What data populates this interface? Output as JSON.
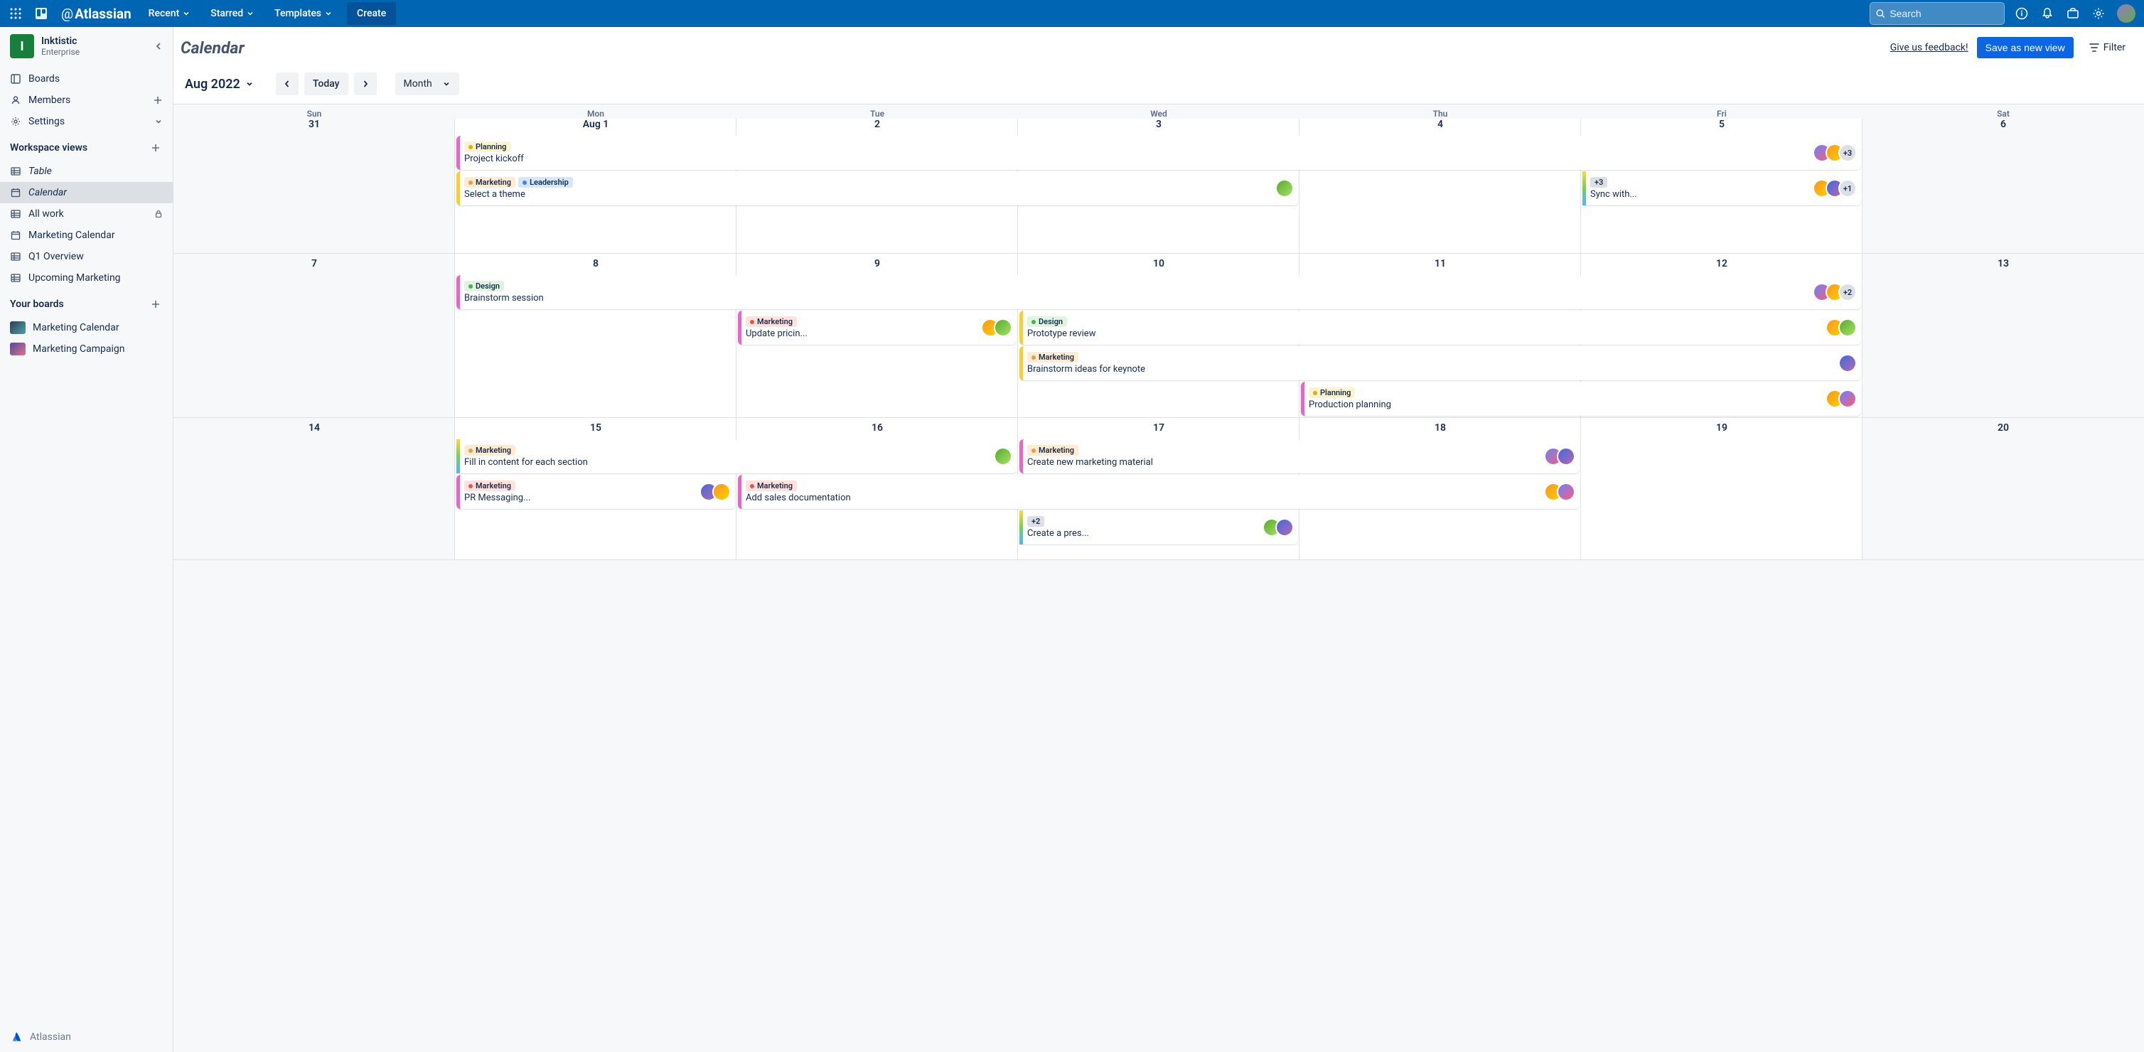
{
  "topbar": {
    "brand": "Atlassian",
    "menus": {
      "recent": "Recent",
      "starred": "Starred",
      "templates": "Templates"
    },
    "create": "Create",
    "search_placeholder": "Search"
  },
  "workspace": {
    "initial": "I",
    "name": "Inktistic",
    "plan": "Enterprise"
  },
  "sidebar": {
    "boards": "Boards",
    "members": "Members",
    "settings": "Settings",
    "section_views": "Workspace views",
    "views": {
      "table": "Table",
      "calendar": "Calendar",
      "allwork": "All work",
      "marketing_cal": "Marketing Calendar",
      "q1": "Q1 Overview",
      "upcoming": "Upcoming Marketing"
    },
    "section_boards": "Your boards",
    "user_boards": {
      "b1": "Marketing Calendar",
      "b2": "Marketing Campaign"
    },
    "footer": "Atlassian"
  },
  "header": {
    "title": "Calendar",
    "feedback": "Give us feedback!",
    "save": "Save as new view",
    "filter": "Filter"
  },
  "toolbar": {
    "month_label": "Aug 2022",
    "today": "Today",
    "view": "Month"
  },
  "calendar": {
    "day_names": [
      "Sun",
      "Mon",
      "Tue",
      "Wed",
      "Thu",
      "Fri",
      "Sat"
    ],
    "week1_dates": [
      "31",
      "Aug 1",
      "2",
      "3",
      "4",
      "5",
      "6"
    ],
    "week2_dates": [
      "7",
      "8",
      "9",
      "10",
      "11",
      "12",
      "13"
    ],
    "week3_dates": [
      "14",
      "15",
      "16",
      "17",
      "18",
      "19",
      "20"
    ],
    "labels": {
      "planning": "Planning",
      "marketing": "Marketing",
      "leadership": "Leadership",
      "design": "Design",
      "plus3": "+3",
      "plus2": "+2",
      "plus1": "+1"
    },
    "events": {
      "kickoff": "Project kickoff",
      "theme": "Select a theme",
      "sync": "Sync with...",
      "brainstorm": "Brainstorm session",
      "pricing": "Update pricin...",
      "prototype": "Prototype review",
      "keynote": "Brainstorm ideas for keynote",
      "production": "Production planning",
      "fillcontent": "Fill in content for each section",
      "pr": "PR Messaging...",
      "newmkt": "Create new marketing material",
      "salesdoc": "Add sales documentation",
      "createpres": "Create a pres..."
    }
  }
}
